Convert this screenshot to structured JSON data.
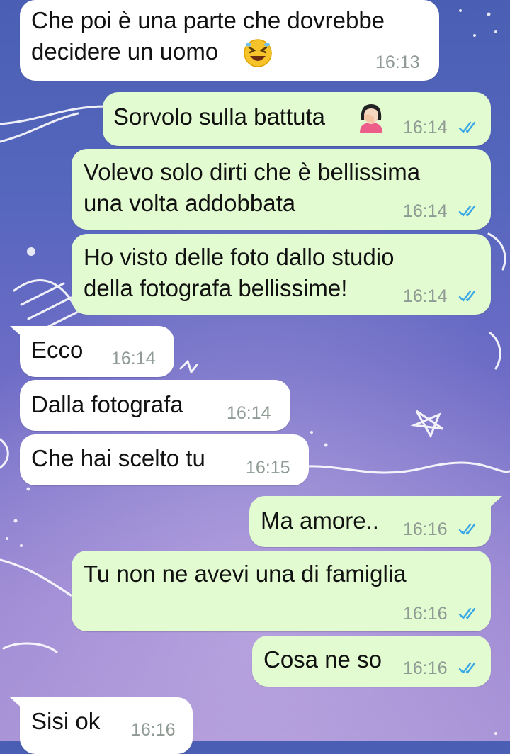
{
  "colors": {
    "incoming_bubble": "#ffffff",
    "outgoing_bubble": "#e2fbd0",
    "read_ticks": "#3ba8e6",
    "timestamp": "#8e9a93"
  },
  "messages": [
    {
      "dir": "in",
      "lines": [
        "Che poi è una parte che dovrebbe",
        "decidere un uomo"
      ],
      "emoji": "rolling-on-floor-laughing-emoji",
      "time": "16:13"
    },
    {
      "dir": "out",
      "lines": [
        "Sorvolo sulla battuta"
      ],
      "emoji": "woman-facepalming-emoji",
      "time": "16:14",
      "status": "read"
    },
    {
      "dir": "out",
      "lines": [
        "Volevo solo dirti che è bellissima",
        "una volta addobbata"
      ],
      "time": "16:14",
      "status": "read"
    },
    {
      "dir": "out",
      "lines": [
        "Ho visto delle foto dallo studio",
        "della fotografa bellissime!"
      ],
      "time": "16:14",
      "status": "read"
    },
    {
      "dir": "in",
      "lines": [
        "Ecco"
      ],
      "time": "16:14"
    },
    {
      "dir": "in",
      "lines": [
        "Dalla fotografa"
      ],
      "time": "16:14"
    },
    {
      "dir": "in",
      "lines": [
        "Che hai scelto tu"
      ],
      "time": "16:15"
    },
    {
      "dir": "out",
      "lines": [
        "Ma amore.."
      ],
      "time": "16:16",
      "status": "read"
    },
    {
      "dir": "out",
      "lines": [
        "Tu non ne avevi una di famiglia"
      ],
      "time": "16:16",
      "status": "read"
    },
    {
      "dir": "out",
      "lines": [
        "Cosa ne so"
      ],
      "time": "16:16",
      "status": "read"
    },
    {
      "dir": "in",
      "lines": [
        "Sisi ok"
      ],
      "time": "16:16"
    }
  ]
}
